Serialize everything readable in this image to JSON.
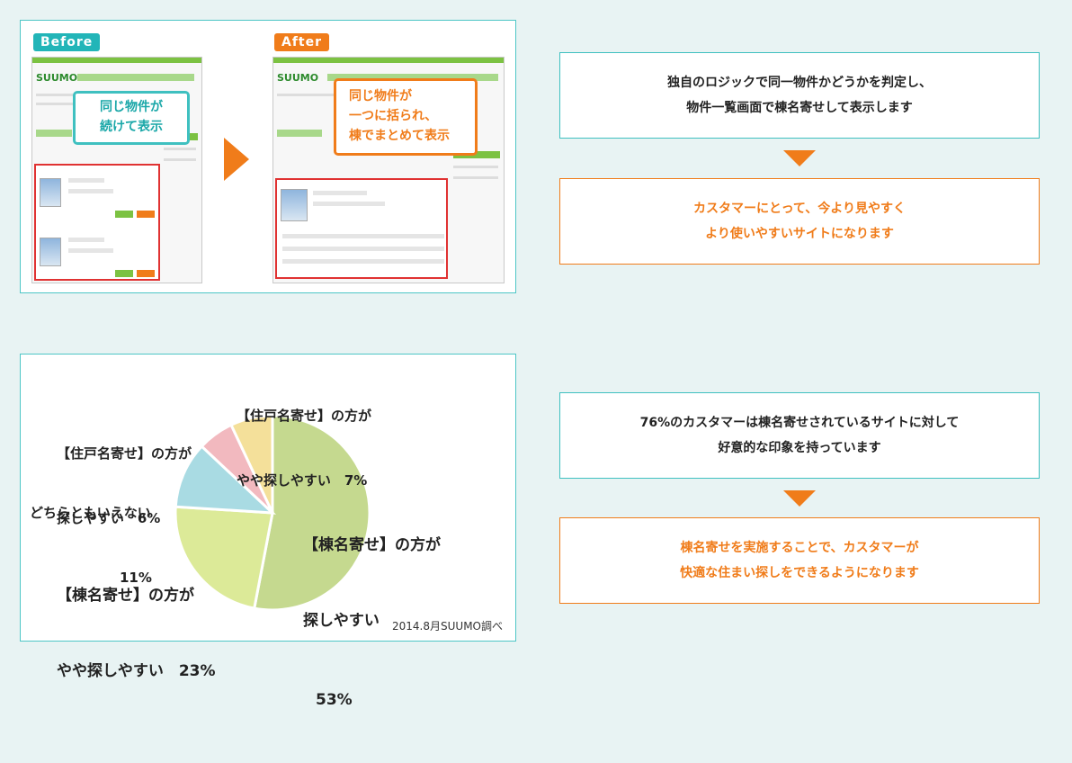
{
  "top": {
    "before_label": "Before",
    "after_label": "After",
    "callout_before": [
      "同じ物件が",
      "続けて表示"
    ],
    "callout_after": [
      "同じ物件が",
      "一つに括られ、",
      "棟でまとめて表示"
    ],
    "screenshot_logo": "SUUMO",
    "info_box": [
      "独自のロジックで同一物件かどうかを判定し、",
      "物件一覧画面で棟名寄せして表示します"
    ],
    "result_box": [
      "カスタマーにとって、今より見やすく",
      "より使いやすいサイトになります"
    ]
  },
  "bottom": {
    "info_box": [
      "76%のカスタマーは棟名寄せされているサイトに対して",
      "好意的な印象を持っています"
    ],
    "result_box": [
      "棟名寄せを実施することで、カスタマーが",
      "快適な住まい探しをできるようになります"
    ],
    "labels": {
      "slice_53": [
        "【棟名寄せ】の方が",
        "探しやすい",
        "53%"
      ],
      "slice_23": [
        "【棟名寄せ】の方が",
        "やや探しやすい　23%"
      ],
      "slice_11": [
        "どちらともいえない",
        "11%"
      ],
      "slice_6": [
        "【住戸名寄せ】の方が",
        "探しやすい　6%"
      ],
      "slice_7": [
        "【住戸名寄せ】の方が",
        "やや探しやすい　7%"
      ]
    },
    "source": "2014.8月SUUMO調べ"
  },
  "chart_data": {
    "type": "pie",
    "slices": [
      {
        "label": "【棟名寄せ】の方が探しやすい",
        "value": 53,
        "color": "#c5d98f"
      },
      {
        "label": "【棟名寄せ】の方がやや探しやすい",
        "value": 23,
        "color": "#dcea98"
      },
      {
        "label": "どちらともいえない",
        "value": 11,
        "color": "#a9dbe3"
      },
      {
        "label": "【住戸名寄せ】の方が探しやすい",
        "value": 6,
        "color": "#f2b9bf"
      },
      {
        "label": "【住戸名寄せ】の方がやや探しやすい",
        "value": 7,
        "color": "#f4e09a"
      }
    ],
    "start": "12 o'clock",
    "direction": "clockwise"
  },
  "colors": {
    "teal": "#3fc0c0",
    "orange": "#f07c1a",
    "background": "#e8f3f3"
  }
}
